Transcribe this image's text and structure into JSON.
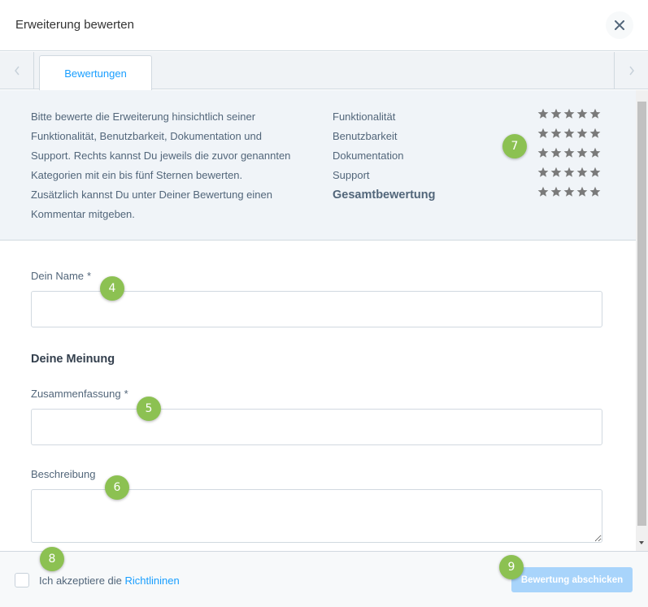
{
  "header": {
    "title": "Erweiterung bewerten",
    "close_icon": "close-icon"
  },
  "tabs": [
    {
      "label": "Bewertungen",
      "active": true
    }
  ],
  "info": {
    "lines": [
      "Bitte bewerte die Erweiterung hinsichtlich seiner",
      "Funktionalität, Benutzbarkeit, Dokumentation und",
      "Support. Rechts kannst Du jeweils die zuvor genannten",
      "Kategorien mit ein bis fünf Sternen bewerten.",
      "Zusätzlich kannst Du unter Deiner Bewertung einen",
      "Kommentar mitgeben."
    ],
    "categories": [
      {
        "label": "Funktionalität",
        "rating": 0
      },
      {
        "label": "Benutzbarkeit",
        "rating": 0
      },
      {
        "label": "Dokumentation",
        "rating": 0
      },
      {
        "label": "Support",
        "rating": 0
      },
      {
        "label": "Gesamtbewertung",
        "rating": 0
      }
    ],
    "star_count": 5
  },
  "form": {
    "name_label": "Dein Name",
    "required_mark": "*",
    "name_value": "",
    "opinion_title": "Deine Meinung",
    "summary_label": "Zusammenfassung",
    "summary_value": "",
    "description_label": "Beschreibung",
    "description_value": ""
  },
  "footer": {
    "accept_prefix": "Ich akzeptiere die",
    "accept_link": "Richtlininen",
    "checked": false,
    "submit_label": "Bewertung abschicken"
  },
  "badges": [
    "4",
    "5",
    "6",
    "7",
    "8",
    "9"
  ],
  "colors": {
    "accent": "#189eff",
    "badge": "#8cc152",
    "submit_disabled": "#a8d4fb",
    "star": "#7a7a7a",
    "info_bg": "#f0f4f8"
  }
}
